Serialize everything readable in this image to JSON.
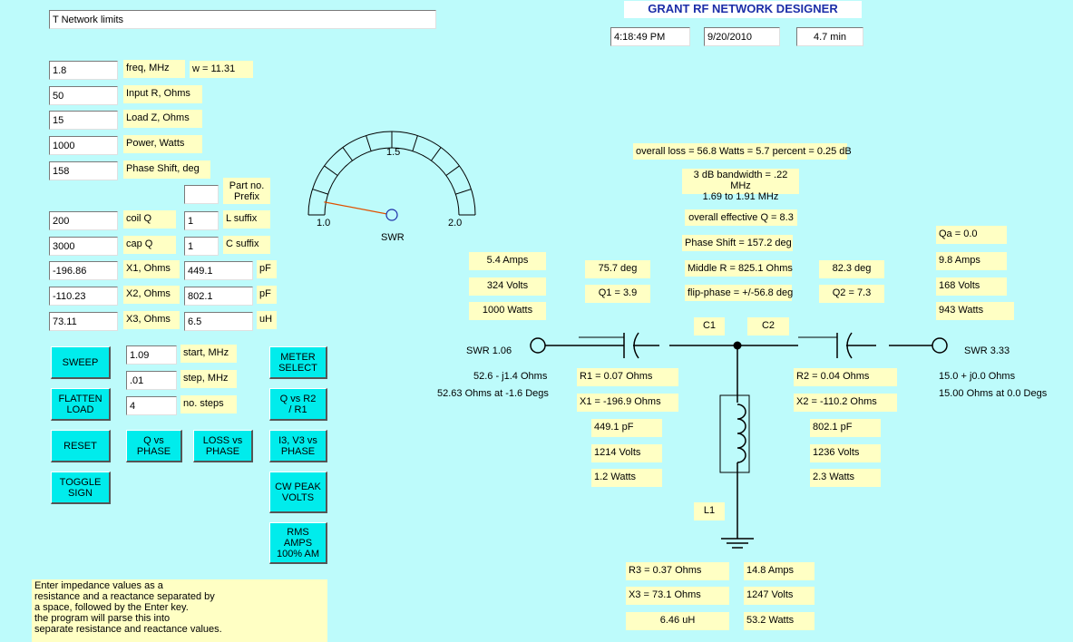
{
  "app_title": "GRANT RF NETWORK DESIGNER",
  "network_name": "T Network limits",
  "clock": {
    "time": "4:18:49 PM",
    "date": "9/20/2010",
    "elapsed": "4.7 min"
  },
  "inputs": {
    "freq": {
      "value": "1.8",
      "label": "freq, MHz"
    },
    "omega": "w = 11.31",
    "input_r": {
      "value": "50",
      "label": "Input R, Ohms"
    },
    "load_z": {
      "value": "15",
      "label": "Load Z, Ohms"
    },
    "power": {
      "value": "1000",
      "label": "Power, Watts"
    },
    "phase_shift": {
      "value": "158",
      "label": "Phase Shift, deg"
    },
    "part_prefix": {
      "value": "",
      "label": "Part no.\nPrefix"
    },
    "coil_q": {
      "value": "200",
      "label": "coil Q"
    },
    "l_suffix": {
      "value": "1",
      "label": "L suffix"
    },
    "cap_q": {
      "value": "3000",
      "label": "cap Q"
    },
    "c_suffix": {
      "value": "1",
      "label": "C suffix"
    },
    "x1": {
      "value": "-196.86",
      "label": "X1, Ohms",
      "comp": "449.1",
      "unit": "pF"
    },
    "x2": {
      "value": "-110.23",
      "label": "X2, Ohms",
      "comp": "802.1",
      "unit": "pF"
    },
    "x3": {
      "value": "73.11",
      "label": "X3, Ohms",
      "comp": "6.5",
      "unit": "uH"
    }
  },
  "sweep": {
    "start": {
      "value": "1.09",
      "label": "start, MHz"
    },
    "step": {
      "value": ".01",
      "label": "step, MHz"
    },
    "steps": {
      "value": "4",
      "label": "no. steps"
    }
  },
  "buttons": {
    "sweep": "SWEEP",
    "flatten": "FLATTEN\nLOAD",
    "reset": "RESET",
    "toggle": "TOGGLE\nSIGN",
    "q_phase": "Q vs\nPHASE",
    "loss_phase": "LOSS vs\nPHASE",
    "meter": "METER\nSELECT",
    "q_r2r1": "Q vs    R2\n/ R1",
    "i3v3": "I3, V3 vs\nPHASE",
    "cw_peak": "CW PEAK\nVOLTS",
    "rms_amps": "RMS AMPS\n100% AM"
  },
  "meter": {
    "min": "1.0",
    "mid": "1.5",
    "max": "2.0",
    "label": "SWR",
    "value": 1.06
  },
  "help_text": "Enter impedance values as a\nresistance and a reactance separated by\na space, followed by the Enter key.\nthe program will parse this into\nseparate resistance and reactance values.",
  "results": {
    "overall_loss": "overall loss = 56.8 Watts = 5.7 percent = 0.25 dB",
    "bandwidth": "3 dB bandwidth = .22 MHz\n1.69 to 1.91 MHz",
    "effective_q": "overall effective Q = 8.3",
    "phase_shift": "Phase Shift = 157.2 deg",
    "middle_r": "Middle R = 825.1 Ohms",
    "flip_phase": "flip-phase = +/-56.8 deg"
  },
  "input_side": {
    "amps": "5.4 Amps",
    "volts": "324 Volts",
    "watts": "1000 Watts",
    "swr": "SWR 1.06",
    "z": "52.6 - j1.4 Ohms",
    "z_polar": "52.63 Ohms at -1.6 Degs"
  },
  "output_side": {
    "qa": "Qa = 0.0",
    "amps": "9.8 Amps",
    "volts": "168 Volts",
    "watts": "943 Watts",
    "swr": "SWR 3.33",
    "z": "15.0 + j0.0 Ohms",
    "z_polar": "15.00 Ohms at 0.0 Degs"
  },
  "c1": {
    "label": "C1",
    "deg": "75.7 deg",
    "q": "Q1 = 3.9",
    "r": "R1 = 0.07 Ohms",
    "x": "X1 = -196.9 Ohms",
    "value": "449.1 pF",
    "volts": "1214 Volts",
    "watts": "1.2 Watts"
  },
  "c2": {
    "label": "C2",
    "deg": "82.3 deg",
    "q": "Q2 = 7.3",
    "r": "R2 = 0.04 Ohms",
    "x": "X2 = -110.2 Ohms",
    "value": "802.1 pF",
    "volts": "1236 Volts",
    "watts": "2.3 Watts"
  },
  "l1": {
    "label": "L1",
    "r": "R3 = 0.37 Ohms",
    "x": "X3 = 73.1 Ohms",
    "value": "6.46 uH",
    "amps": "14.8 Amps",
    "volts": "1247 Volts",
    "watts": "53.2 Watts"
  }
}
